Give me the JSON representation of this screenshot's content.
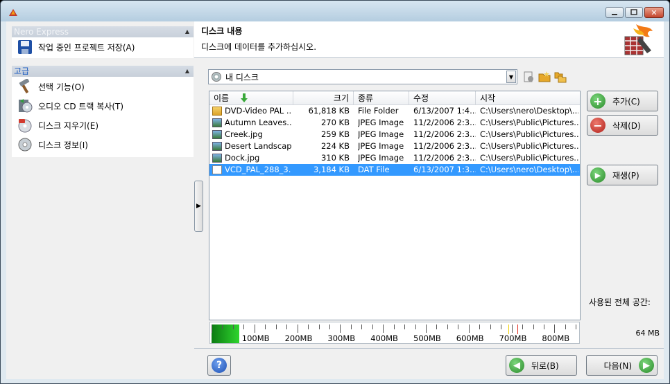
{
  "sidebar": {
    "group1": {
      "title": "Nero Express",
      "items": [
        {
          "label": "작업 중인 프로젝트 저장(A)",
          "icon": "floppy-disk-icon"
        }
      ]
    },
    "group2": {
      "title": "고급",
      "items": [
        {
          "label": "선택 기능(O)",
          "icon": "hammer-icon"
        },
        {
          "label": "오디오 CD 트랙 복사(T)",
          "icon": "audio-cd-copy-icon"
        },
        {
          "label": "디스크 지우기(E)",
          "icon": "erase-disc-icon"
        },
        {
          "label": "디스크 정보(I)",
          "icon": "disc-info-icon"
        }
      ]
    }
  },
  "header": {
    "title": "디스크 내용",
    "subtitle": "디스크에 데이터를 추가하십시오."
  },
  "combo": {
    "value": "내 디스크"
  },
  "columns": [
    "이름",
    "크기",
    "종류",
    "수정",
    "시작"
  ],
  "files": [
    {
      "name": "DVD-Video PAL ...",
      "size": "61,818 KB",
      "type": "File Folder",
      "modified": "6/13/2007 1:4...",
      "origin": "C:\\Users\\nero\\Desktop\\...",
      "icon": "folder-icon",
      "selected": false
    },
    {
      "name": "Autumn Leaves....",
      "size": "270 KB",
      "type": "JPEG Image",
      "modified": "11/2/2006 2:3...",
      "origin": "C:\\Users\\Public\\Pictures...",
      "icon": "image-icon",
      "selected": false
    },
    {
      "name": "Creek.jpg",
      "size": "259 KB",
      "type": "JPEG Image",
      "modified": "11/2/2006 2:3...",
      "origin": "C:\\Users\\Public\\Pictures...",
      "icon": "image-icon",
      "selected": false
    },
    {
      "name": "Desert Landscap...",
      "size": "224 KB",
      "type": "JPEG Image",
      "modified": "11/2/2006 2:3...",
      "origin": "C:\\Users\\Public\\Pictures...",
      "icon": "image-icon",
      "selected": false
    },
    {
      "name": "Dock.jpg",
      "size": "310 KB",
      "type": "JPEG Image",
      "modified": "11/2/2006 2:3...",
      "origin": "C:\\Users\\Public\\Pictures...",
      "icon": "image-icon",
      "selected": false
    },
    {
      "name": "VCD_PAL_288_3...",
      "size": "3,184 KB",
      "type": "DAT File",
      "modified": "6/13/2007 1:3...",
      "origin": "C:\\Users\\nero\\Desktop\\...",
      "icon": "file-icon",
      "selected": true
    }
  ],
  "capacity": {
    "labels": [
      "100MB",
      "200MB",
      "300MB",
      "400MB",
      "500MB",
      "600MB",
      "700MB",
      "800MB"
    ],
    "used_mb": 64
  },
  "buttons": {
    "add": "추가(C)",
    "delete": "삭제(D)",
    "play": "재생(P)",
    "back": "뒤로(B)",
    "next": "다음(N)"
  },
  "used_space": {
    "label": "사용된 전체 공간:",
    "value": "64 MB"
  },
  "colors": {
    "selection": "#3399ff",
    "capacity_fill": "#2ed52e",
    "add": "#3aa83a",
    "delete": "#c0271f",
    "nav": "#3aa83a"
  }
}
